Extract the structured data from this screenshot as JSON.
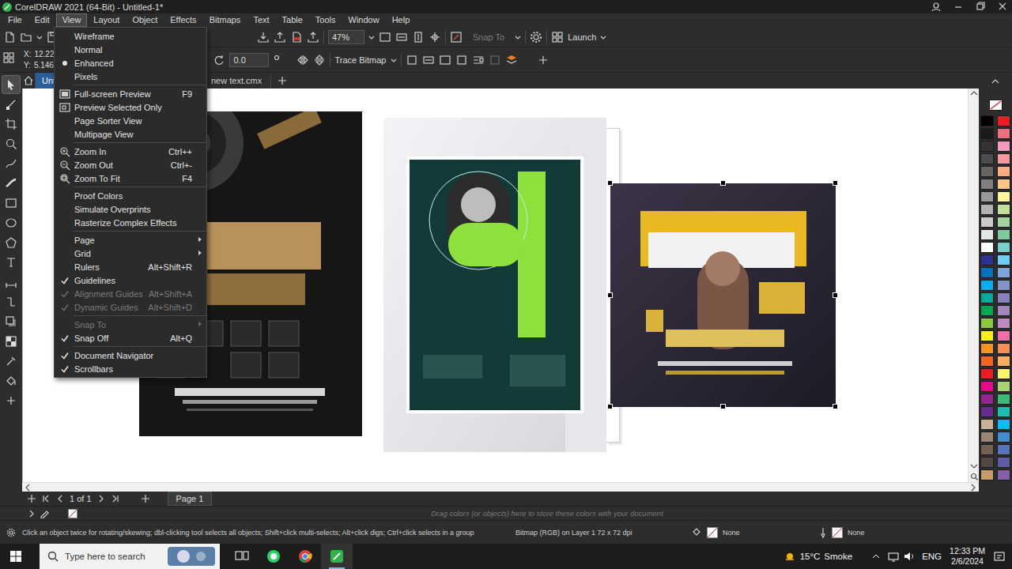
{
  "window": {
    "title": "CorelDRAW 2021 (64-Bit) - Untitled-1*"
  },
  "menubar": [
    {
      "label": "File",
      "selected": false
    },
    {
      "label": "Edit",
      "selected": false
    },
    {
      "label": "View",
      "selected": true
    },
    {
      "label": "Layout",
      "selected": false
    },
    {
      "label": "Object",
      "selected": false
    },
    {
      "label": "Effects",
      "selected": false
    },
    {
      "label": "Bitmaps",
      "selected": false
    },
    {
      "label": "Text",
      "selected": false
    },
    {
      "label": "Table",
      "selected": false
    },
    {
      "label": "Tools",
      "selected": false
    },
    {
      "label": "Window",
      "selected": false
    },
    {
      "label": "Help",
      "selected": false
    }
  ],
  "toolbar": {
    "zoom": "47%",
    "snap_to": {
      "label": "Snap To",
      "disabled": true
    },
    "launch": "Launch"
  },
  "property_bar": {
    "x_label": "X:",
    "x_value": "12.22",
    "y_label": "Y:",
    "y_value": "5.146",
    "rotation": "0.0",
    "trace_bitmap": "Trace Bitmap"
  },
  "doc_tabs": [
    {
      "label": "Unti",
      "selected": true
    },
    {
      "label": "new text.cmx",
      "selected": false
    }
  ],
  "toolbox": [
    {
      "selected": true
    },
    {
      "selected": false
    },
    {
      "selected": false
    },
    {
      "selected": false
    },
    {
      "selected": false
    },
    {
      "selected": false
    },
    {
      "selected": false
    },
    {
      "selected": false
    },
    {
      "selected": false
    },
    {
      "selected": false
    },
    {
      "selected": false
    },
    {
      "selected": false
    },
    {
      "selected": false
    },
    {
      "selected": false
    },
    {
      "selected": false
    },
    {
      "selected": false
    },
    {
      "selected": false
    }
  ],
  "canvas": {
    "objects": [
      {
        "kind": "flyer",
        "selected": false
      },
      {
        "kind": "mockup",
        "selected": false
      },
      {
        "kind": "flyer",
        "selected": true
      }
    ]
  },
  "view_menu": {
    "groups": [
      [
        {
          "label": "Wireframe",
          "kind": "radio",
          "selected": false,
          "disabled": false
        },
        {
          "label": "Normal",
          "kind": "radio",
          "selected": false,
          "disabled": false
        },
        {
          "label": "Enhanced",
          "kind": "radio",
          "selected": true,
          "disabled": false
        },
        {
          "label": "Pixels",
          "kind": "radio",
          "selected": false,
          "disabled": false
        }
      ],
      [
        {
          "label": "Full-screen Preview",
          "shortcut": "F9",
          "kind": "command",
          "disabled": false
        },
        {
          "label": "Preview Selected Only",
          "kind": "command",
          "disabled": false
        },
        {
          "label": "Page Sorter View",
          "kind": "command",
          "disabled": false
        },
        {
          "label": "Multipage View",
          "kind": "command",
          "disabled": false
        }
      ],
      [
        {
          "label": "Zoom In",
          "shortcut": "Ctrl++",
          "kind": "command",
          "disabled": false
        },
        {
          "label": "Zoom Out",
          "shortcut": "Ctrl+-",
          "kind": "command",
          "disabled": false
        },
        {
          "label": "Zoom To Fit",
          "shortcut": "F4",
          "kind": "command",
          "disabled": false
        }
      ],
      [
        {
          "label": "Proof Colors",
          "kind": "check",
          "checked": false,
          "disabled": false
        },
        {
          "label": "Simulate Overprints",
          "kind": "check",
          "checked": false,
          "disabled": false
        },
        {
          "label": "Rasterize Complex Effects",
          "kind": "check",
          "checked": false,
          "disabled": false
        }
      ],
      [
        {
          "label": "Page",
          "kind": "submenu",
          "disabled": false
        },
        {
          "label": "Grid",
          "kind": "submenu",
          "disabled": false
        },
        {
          "label": "Rulers",
          "shortcut": "Alt+Shift+R",
          "kind": "check",
          "checked": false,
          "disabled": false
        },
        {
          "label": "Guidelines",
          "kind": "check",
          "checked": true,
          "disabled": false
        },
        {
          "label": "Alignment Guides",
          "shortcut": "Alt+Shift+A",
          "kind": "check",
          "checked": true,
          "disabled": true
        },
        {
          "label": "Dynamic Guides",
          "shortcut": "Alt+Shift+D",
          "kind": "check",
          "checked": true,
          "disabled": true
        }
      ],
      [
        {
          "label": "Snap To",
          "kind": "submenu",
          "disabled": true
        },
        {
          "label": "Snap Off",
          "shortcut": "Alt+Q",
          "kind": "check",
          "checked": true,
          "disabled": false
        }
      ],
      [
        {
          "label": "Document Navigator",
          "kind": "check",
          "checked": true,
          "disabled": false
        },
        {
          "label": "Scrollbars",
          "kind": "check",
          "checked": true,
          "disabled": false
        }
      ]
    ]
  },
  "page_nav": {
    "count": "1 of 1",
    "page": "Page 1"
  },
  "docker": {
    "hint": "Drag colors (or objects) here to store these colors with your document"
  },
  "palette": {
    "columns": [
      [
        {
          "color": "#000000"
        },
        {
          "color": "#1a1a1a"
        },
        {
          "color": "#333333"
        },
        {
          "color": "#4d4d4d"
        },
        {
          "color": "#666666"
        },
        {
          "color": "#808080"
        },
        {
          "color": "#999999"
        },
        {
          "color": "#b3b3b3"
        },
        {
          "color": "#cccccc"
        },
        {
          "color": "#e6e6e6"
        },
        {
          "color": "#ffffff"
        },
        {
          "color": "#2e3192"
        },
        {
          "color": "#0072bc"
        },
        {
          "color": "#00aeef"
        },
        {
          "color": "#00a99d"
        },
        {
          "color": "#00a651"
        },
        {
          "color": "#8dc63f"
        },
        {
          "color": "#fff200"
        },
        {
          "color": "#f7941d"
        },
        {
          "color": "#f26522"
        },
        {
          "color": "#ed1c24"
        },
        {
          "color": "#ec008c"
        },
        {
          "color": "#92278f"
        },
        {
          "color": "#662d91"
        },
        {
          "color": "#c7b299"
        },
        {
          "color": "#998675"
        },
        {
          "color": "#736357"
        },
        {
          "color": "#534741"
        },
        {
          "color": "#c69c6d"
        }
      ],
      [
        {
          "color": "#ed1c24"
        },
        {
          "color": "#f26d7d"
        },
        {
          "color": "#f49ac1"
        },
        {
          "color": "#f5989d"
        },
        {
          "color": "#f9ad81"
        },
        {
          "color": "#fdc689"
        },
        {
          "color": "#fff799"
        },
        {
          "color": "#c4df9b"
        },
        {
          "color": "#a3d39c"
        },
        {
          "color": "#82ca9d"
        },
        {
          "color": "#7bcdc8"
        },
        {
          "color": "#6dcff6"
        },
        {
          "color": "#7da7d9"
        },
        {
          "color": "#8393ca"
        },
        {
          "color": "#8781bd"
        },
        {
          "color": "#a186be"
        },
        {
          "color": "#bd8cbf"
        },
        {
          "color": "#f06eaa"
        },
        {
          "color": "#f68e56"
        },
        {
          "color": "#fbaf5d"
        },
        {
          "color": "#fff568"
        },
        {
          "color": "#acd373"
        },
        {
          "color": "#3cb878"
        },
        {
          "color": "#1cbbb4"
        },
        {
          "color": "#00bff3"
        },
        {
          "color": "#448ccb"
        },
        {
          "color": "#5674b9"
        },
        {
          "color": "#605ca8"
        },
        {
          "color": "#855fa8"
        }
      ]
    ]
  },
  "status_bar": {
    "hint": "Click an object twice for rotating/skewing; dbl-clicking tool selects all objects; Shift+click multi-selects; Alt+click digs; Ctrl+click selects in a group",
    "object_info": "Bitmap (RGB) on Layer 1 72 x 72 dpi",
    "fill": "None",
    "outline": "None"
  },
  "taskbar": {
    "search_placeholder": "Type here to search",
    "apps": [
      {
        "active": false
      },
      {
        "active": false
      },
      {
        "active": false
      },
      {
        "active": true
      }
    ],
    "weather": {
      "temp": "15°C",
      "condition": "Smoke"
    },
    "language": "ENG",
    "time": "12:33 PM",
    "date": "2/6/2024"
  }
}
